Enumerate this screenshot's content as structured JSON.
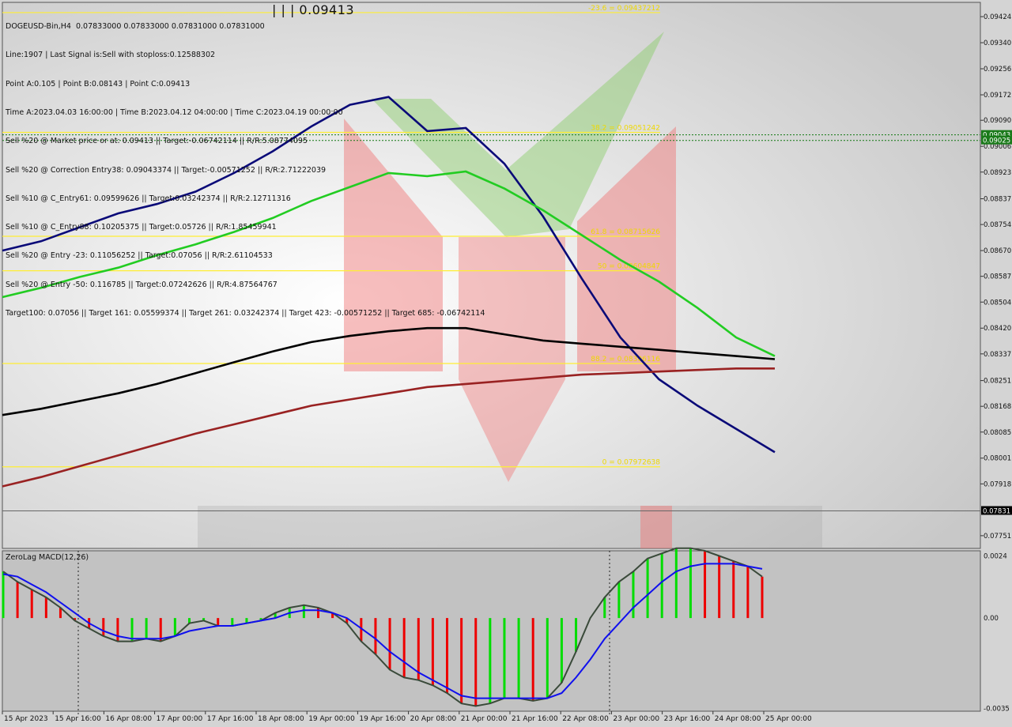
{
  "header": {
    "lines": [
      "DOGEUSD-Bin,H4  0.07833000 0.07833000 0.07831000 0.07831000",
      "Line:1907 | Last Signal is:Sell with stoploss:0.12588302",
      "Point A:0.105 | Point B:0.08143 | Point C:0.09413",
      "Time A:2023.04.03 16:00:00 | Time B:2023.04.12 04:00:00 | Time C:2023.04.19 00:00:00",
      "Sell %20 @ Market price or at: 0.09413 || Target:-0.06742114 || R/R:5.08774095",
      "Sell %20 @ Correction Entry38: 0.09043374 || Target:-0.00571252 || R/R:2.71222039",
      "Sell %10 @ C_Entry61: 0.09599626 || Target:0.03242374 || R/R:2.12711316",
      "Sell %10 @ C_Entry88: 0.10205375 || Target:0.05726 || R/R:1.85459941",
      "Sell %20 @ Entry -23: 0.11056252 || Target:0.07056 || R/R:2.61104533",
      "Sell %20 @ Entry -50: 0.116785 || Target:0.07242626 || R/R:4.87564767",
      "Target100: 0.07056 || Target 161: 0.05599374 || Target 261: 0.03242374 || Target 423: -0.00571252 || Target 685: -0.06742114"
    ],
    "big_label": "| | | 0.09413"
  },
  "chart_data": [
    {
      "type": "line",
      "title": "DOGEUSD-Bin,H4",
      "x_labels": [
        "15 Apr 2023",
        "15 Apr 16:00",
        "16 Apr 08:00",
        "17 Apr 00:00",
        "17 Apr 16:00",
        "18 Apr 08:00",
        "19 Apr 00:00",
        "19 Apr 16:00",
        "20 Apr 08:00",
        "21 Apr 00:00",
        "21 Apr 16:00",
        "22 Apr 08:00",
        "23 Apr 00:00",
        "23 Apr 16:00",
        "24 Apr 08:00",
        "25 Apr 00:00"
      ],
      "ylim": [
        0.0771,
        0.0947
      ],
      "y_ticks": [
        0.09424,
        0.0934,
        0.09256,
        0.09172,
        0.0909,
        0.09006,
        0.08923,
        0.08837,
        0.08754,
        0.0867,
        0.08587,
        0.08504,
        0.0842,
        0.08337,
        0.08251,
        0.08168,
        0.08085,
        0.08001,
        0.07918,
        0.07751
      ],
      "current_price": "0.07831",
      "badge_labels": [
        "0.09043",
        "0.09025"
      ],
      "levels": [
        {
          "label": "-23.6 = 0.09437212",
          "value": 0.09437
        },
        {
          "label": "38.2 = 0.09051242",
          "value": 0.09051
        },
        {
          "label": "61.8 = 0.08715626",
          "value": 0.08716
        },
        {
          "label": "50 = 0.08604847",
          "value": 0.08605
        },
        {
          "label": "88.2 = 0.08306116",
          "value": 0.08306
        },
        {
          "label": "0 = 0.07972638",
          "value": 0.07973
        }
      ],
      "series": [
        {
          "name": "",
          "color": "#0a0a78",
          "values": [
            0.0867,
            0.087,
            0.08745,
            0.0879,
            0.0882,
            0.0886,
            0.0892,
            0.0899,
            0.0907,
            0.0914,
            0.09165,
            0.09055,
            0.09065,
            0.0895,
            0.0878,
            0.0858,
            0.0839,
            0.08255,
            0.0817,
            0.08095,
            0.0802
          ]
        },
        {
          "name": "",
          "color": "#22cc22",
          "values": [
            0.0852,
            0.0855,
            0.08585,
            0.08615,
            0.08655,
            0.0869,
            0.0873,
            0.08775,
            0.0883,
            0.08875,
            0.0892,
            0.0891,
            0.08925,
            0.0887,
            0.088,
            0.0872,
            0.0864,
            0.0857,
            0.08485,
            0.0839,
            0.0833
          ]
        },
        {
          "name": "",
          "color": "#000000",
          "values": [
            0.0814,
            0.0816,
            0.08185,
            0.0821,
            0.0824,
            0.08275,
            0.0831,
            0.08345,
            0.08375,
            0.08395,
            0.0841,
            0.0842,
            0.0842,
            0.084,
            0.0838,
            0.0837,
            0.0836,
            0.0835,
            0.0834,
            0.0833,
            0.0832
          ]
        },
        {
          "name": "",
          "color": "#992222",
          "values": [
            0.0791,
            0.0794,
            0.07975,
            0.0801,
            0.08045,
            0.0808,
            0.0811,
            0.0814,
            0.0817,
            0.0819,
            0.0821,
            0.0823,
            0.0824,
            0.0825,
            0.0826,
            0.0827,
            0.08275,
            0.0828,
            0.08285,
            0.0829,
            0.0829
          ]
        }
      ]
    },
    {
      "type": "bar",
      "title": "ZeroLag MACD(12,26)",
      "ylim": [
        -0.0036,
        0.0026
      ],
      "y_ticks": [
        "0.0024",
        "0.00",
        "-0.0035"
      ],
      "histogram": [
        0.0018,
        0.0014,
        0.0011,
        0.0008,
        0.0004,
        -0.0001,
        -0.0004,
        -0.0007,
        -0.0009,
        -0.0009,
        -0.0008,
        -0.0009,
        -0.0007,
        -0.0002,
        -0.0001,
        -0.0003,
        -0.0003,
        -0.0002,
        -0.0001,
        0.0002,
        0.0004,
        0.0005,
        0.0004,
        0.0002,
        -0.0002,
        -0.0009,
        -0.0014,
        -0.002,
        -0.0023,
        -0.0024,
        -0.0026,
        -0.0029,
        -0.0033,
        -0.0034,
        -0.0033,
        -0.0031,
        -0.0031,
        -0.0032,
        -0.0031,
        -0.0025,
        -0.0013,
        0.0,
        0.0008,
        0.0014,
        0.0018,
        0.0023,
        0.0025,
        0.0027,
        0.0027,
        0.0026,
        0.0024,
        0.0022,
        0.002,
        0.0016
      ],
      "signal": [
        0.0017,
        0.0016,
        0.0013,
        0.001,
        0.0006,
        0.0002,
        -0.0002,
        -0.0005,
        -0.0007,
        -0.0008,
        -0.0008,
        -0.0008,
        -0.0007,
        -0.0005,
        -0.0004,
        -0.0003,
        -0.0003,
        -0.0002,
        -0.0001,
        0.0,
        0.0002,
        0.0003,
        0.0003,
        0.0002,
        0.0,
        -0.0004,
        -0.0008,
        -0.0013,
        -0.0017,
        -0.0021,
        -0.0024,
        -0.0027,
        -0.003,
        -0.0031,
        -0.0031,
        -0.0031,
        -0.0031,
        -0.0031,
        -0.0031,
        -0.0029,
        -0.0023,
        -0.0016,
        -0.0008,
        -0.0002,
        0.0004,
        0.0009,
        0.0014,
        0.0018,
        0.002,
        0.0021,
        0.0021,
        0.0021,
        0.002,
        0.0019
      ]
    }
  ]
}
